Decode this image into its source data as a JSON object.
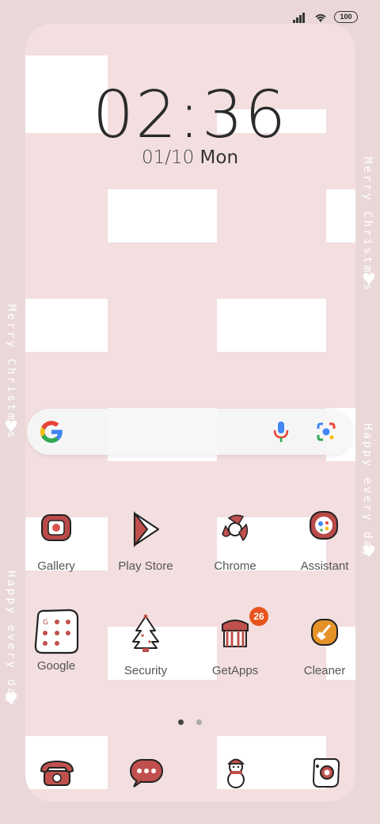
{
  "status_bar": {
    "battery": "100",
    "icons": [
      "signal-icon",
      "wifi-icon",
      "battery-icon"
    ]
  },
  "lock": {
    "time": "02:36",
    "date_md": "01/10",
    "day": "Mon"
  },
  "side_texts": {
    "left_top": "Merry Christmas",
    "left_bottom": "Happy every day",
    "right_top": "Merry Christmas",
    "right_bottom": "Happy every day"
  },
  "search_bar": {
    "icons": [
      "google-g-icon",
      "mic-icon",
      "lens-icon"
    ]
  },
  "apps_row1": [
    {
      "label": "Gallery",
      "icon": "gallery-icon"
    },
    {
      "label": "Play Store",
      "icon": "play-store-icon"
    },
    {
      "label": "Chrome",
      "icon": "chrome-icon"
    },
    {
      "label": "Assistant",
      "icon": "assistant-icon"
    }
  ],
  "apps_row2": [
    {
      "label": "Google",
      "icon": "google-folder-icon"
    },
    {
      "label": "Security",
      "icon": "security-icon"
    },
    {
      "label": "GetApps",
      "icon": "getapps-icon",
      "badge": "26"
    },
    {
      "label": "Cleaner",
      "icon": "cleaner-icon"
    }
  ],
  "page_indicator": {
    "pages": 2,
    "current": 1
  },
  "dock": [
    "phone-icon",
    "messages-icon",
    "snowman-camera-icon",
    "camera-icon"
  ],
  "colors": {
    "pink": "#f3dfe0",
    "outer": "#ead8d8",
    "accent_red": "#c0504d",
    "badge": "#e8541e"
  }
}
